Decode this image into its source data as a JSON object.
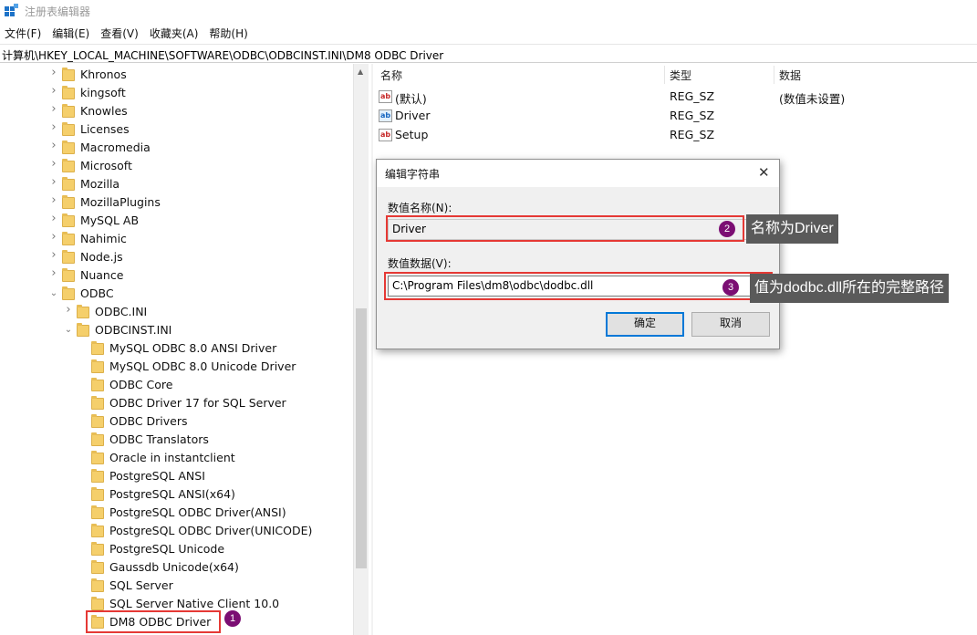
{
  "window": {
    "title": "注册表编辑器",
    "icon": "regedit-icon"
  },
  "menu": [
    "文件(F)",
    "编辑(E)",
    "查看(V)",
    "收藏夹(A)",
    "帮助(H)"
  ],
  "address": "计算机\\HKEY_LOCAL_MACHINE\\SOFTWARE\\ODBC\\ODBCINST.INI\\DM8 ODBC Driver",
  "tree": {
    "level1": [
      "Khronos",
      "kingsoft",
      "Knowles",
      "Licenses",
      "Macromedia",
      "Microsoft",
      "Mozilla",
      "MozillaPlugins",
      "MySQL AB",
      "Nahimic",
      "Node.js",
      "Nuance",
      "ODBC"
    ],
    "odbc_children": [
      "ODBC.INI",
      "ODBCINST.INI"
    ],
    "odbcinst_children": [
      "MySQL ODBC 8.0 ANSI Driver",
      "MySQL ODBC 8.0 Unicode Driver",
      "ODBC Core",
      "ODBC Driver 17 for SQL Server",
      "ODBC Drivers",
      "ODBC Translators",
      "Oracle in instantclient",
      "PostgreSQL ANSI",
      "PostgreSQL ANSI(x64)",
      "PostgreSQL ODBC Driver(ANSI)",
      "PostgreSQL ODBC Driver(UNICODE)",
      "PostgreSQL Unicode",
      "Gaussdb Unicode(x64)",
      "SQL Server",
      "SQL Server Native Client 10.0",
      "DM8 ODBC Driver"
    ]
  },
  "values_pane": {
    "headers": {
      "name": "名称",
      "type": "类型",
      "data": "数据"
    },
    "rows": [
      {
        "name": "(默认)",
        "type": "REG_SZ",
        "data": "(数值未设置)",
        "icon": "ab-red"
      },
      {
        "name": "Driver",
        "type": "REG_SZ",
        "data": "",
        "icon": "ab-blue"
      },
      {
        "name": "Setup",
        "type": "REG_SZ",
        "data": "",
        "icon": "ab-red"
      }
    ]
  },
  "dialog": {
    "title": "编辑字符串",
    "name_label": "数值名称(N):",
    "name_value": "Driver",
    "data_label": "数值数据(V):",
    "data_value": "C:\\Program Files\\dm8\\odbc\\dodbc.dll",
    "ok": "确定",
    "cancel": "取消"
  },
  "annotations": {
    "badge1": "1",
    "badge2": "2",
    "badge3": "3",
    "callout2": "名称为Driver",
    "callout3": "值为dodbc.dll所在的完整路径",
    "highlight_color": "#e53935",
    "badge_color": "#7b0e73"
  }
}
